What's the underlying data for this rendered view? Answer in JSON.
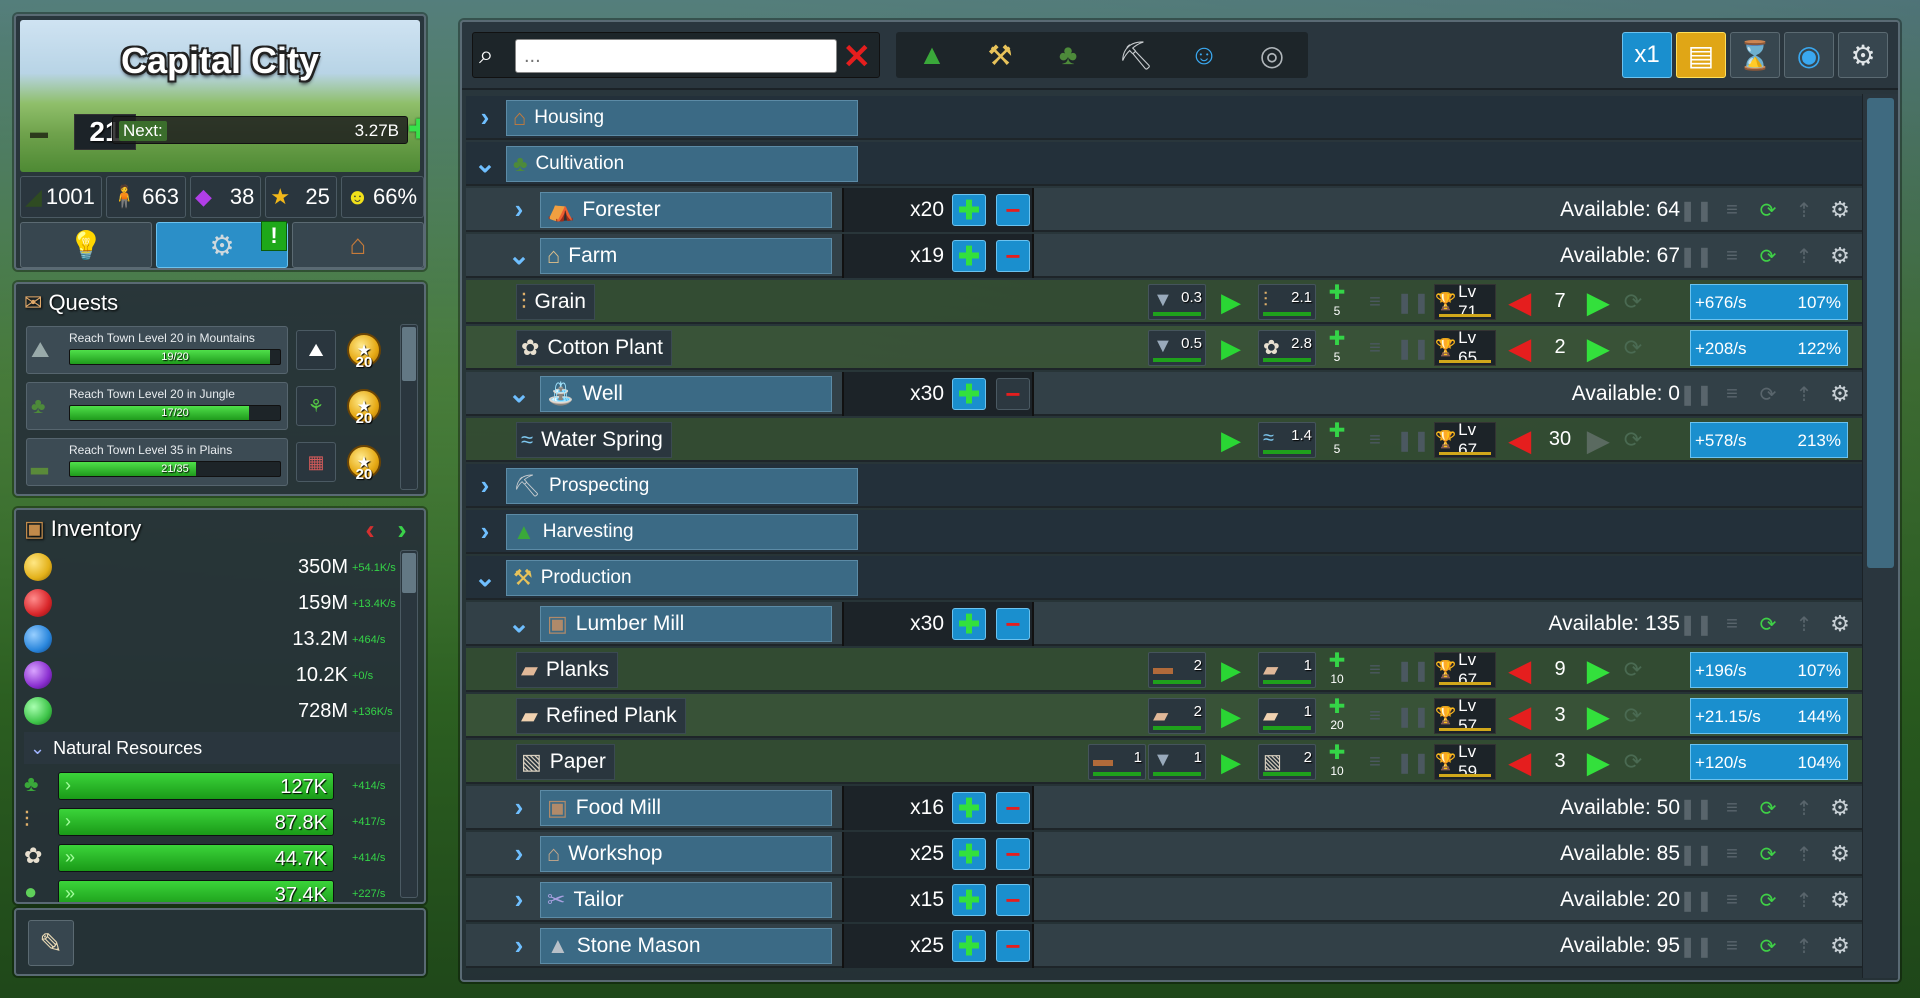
{
  "city": {
    "name": "Capital City",
    "level": "21",
    "next_label": "Next:",
    "next_value": "3.27B",
    "stats": [
      {
        "icon": "tank-icon",
        "value": "1001"
      },
      {
        "icon": "population-icon",
        "value": "663"
      },
      {
        "icon": "gem-icon",
        "value": "38"
      },
      {
        "icon": "star-icon",
        "value": "25"
      },
      {
        "icon": "happiness-icon",
        "value": "66%"
      }
    ],
    "alert_badge": "!"
  },
  "quests": {
    "title": "Quests",
    "items": [
      {
        "text": "Reach Town Level 20 in Mountains",
        "progress": "19/20",
        "fill": 0.95,
        "reward": "20"
      },
      {
        "text": "Reach Town Level 20 in Jungle",
        "progress": "17/20",
        "fill": 0.85,
        "reward": "20"
      },
      {
        "text": "Reach Town Level 35 in Plains",
        "progress": "21/35",
        "fill": 0.6,
        "reward": "20"
      }
    ]
  },
  "inventory": {
    "title": "Inventory",
    "currencies": [
      {
        "color": "#e3b11a",
        "value": "350M",
        "rate": "+54.1K/s"
      },
      {
        "color": "#d9262a",
        "value": "159M",
        "rate": "+13.4K/s"
      },
      {
        "color": "#2a86dc",
        "value": "13.2M",
        "rate": "+464/s"
      },
      {
        "color": "#8a2fd0",
        "value": "10.2K",
        "rate": "+0/s"
      },
      {
        "color": "#3fc54a",
        "value": "728M",
        "rate": "+136K/s"
      }
    ],
    "section_label": "Natural Resources",
    "resources": [
      {
        "value": "127K",
        "rate": "+414/s",
        "fill": 1.0,
        "arrows": "›"
      },
      {
        "value": "87.8K",
        "rate": "+417/s",
        "fill": 1.0,
        "arrows": "›"
      },
      {
        "value": "44.7K",
        "rate": "+414/s",
        "fill": 1.0,
        "arrows": "»"
      },
      {
        "value": "37.4K",
        "rate": "+227/s",
        "fill": 1.0,
        "arrows": "»"
      }
    ]
  },
  "toolbar": {
    "search_placeholder": "...",
    "speed": "x1"
  },
  "categories": {
    "housing": "Housing",
    "cultivation": "Cultivation",
    "prospecting": "Prospecting",
    "harvesting": "Harvesting",
    "production": "Production"
  },
  "buildings": {
    "forester": {
      "name": "Forester",
      "count": "x20",
      "available": "Available: 64"
    },
    "farm": {
      "name": "Farm",
      "count": "x19",
      "available": "Available: 67"
    },
    "well": {
      "name": "Well",
      "count": "x30",
      "available": "Available: 0"
    },
    "lumber_mill": {
      "name": "Lumber Mill",
      "count": "x30",
      "available": "Available: 135"
    },
    "food_mill": {
      "name": "Food Mill",
      "count": "x16",
      "available": "Available: 50"
    },
    "workshop": {
      "name": "Workshop",
      "count": "x25",
      "available": "Available: 85"
    },
    "tailor": {
      "name": "Tailor",
      "count": "x15",
      "available": "Available: 20"
    },
    "stone_mason": {
      "name": "Stone Mason",
      "count": "x25",
      "available": "Available: 95"
    }
  },
  "resources": {
    "grain": {
      "name": "Grain",
      "in1": "0.3",
      "out": "2.1",
      "bonus": "5",
      "level": "Lv 71",
      "workers": "7",
      "rate": "+676/s",
      "pct": "107%"
    },
    "cotton": {
      "name": "Cotton Plant",
      "in1": "0.5",
      "out": "2.8",
      "bonus": "5",
      "level": "Lv 65",
      "workers": "2",
      "rate": "+208/s",
      "pct": "122%"
    },
    "water": {
      "name": "Water Spring",
      "out": "1.4",
      "bonus": "5",
      "level": "Lv 67",
      "workers": "30",
      "rate": "+578/s",
      "pct": "213%"
    },
    "planks": {
      "name": "Planks",
      "in1": "2",
      "out": "1",
      "bonus": "10",
      "level": "Lv 67",
      "workers": "9",
      "rate": "+196/s",
      "pct": "107%"
    },
    "refined": {
      "name": "Refined Plank",
      "in1": "2",
      "out": "1",
      "bonus": "20",
      "level": "Lv 57",
      "workers": "3",
      "rate": "+21.15/s",
      "pct": "144%"
    },
    "paper": {
      "name": "Paper",
      "in1": "1",
      "in2": "1",
      "out": "2",
      "bonus": "10",
      "level": "Lv 59",
      "workers": "3",
      "rate": "+120/s",
      "pct": "104%"
    }
  }
}
